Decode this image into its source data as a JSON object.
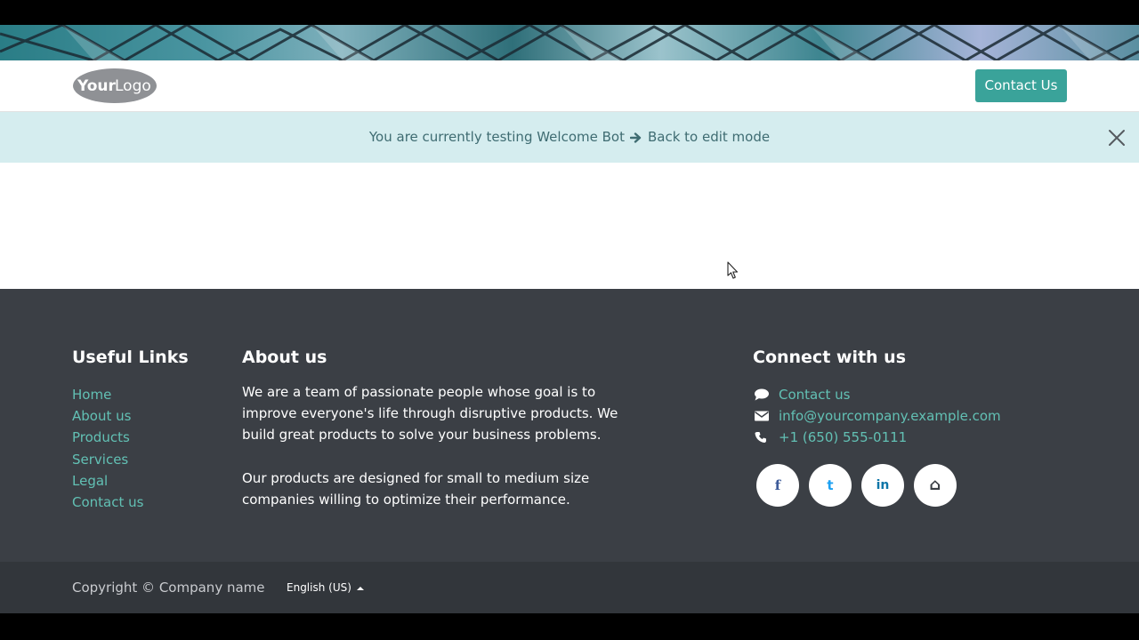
{
  "banner": {
    "image": "geometric-glass-ceiling"
  },
  "navbar": {
    "logo_text_bold": "Your",
    "logo_text_light": "Logo",
    "contact_button": "Contact Us"
  },
  "testbar": {
    "message": "You are currently testing Welcome Bot",
    "back_link": "Back to edit mode",
    "close_icon": "close-icon"
  },
  "footer": {
    "useful_links": {
      "title": "Useful Links",
      "items": [
        "Home",
        "About us",
        "Products",
        "Services",
        "Legal",
        "Contact us"
      ]
    },
    "about": {
      "title": "About us",
      "paragraph1": "We are a team of passionate people whose goal is to improve everyone's life through disruptive products. We build great products to solve your business problems.",
      "paragraph2": "Our products are designed for small to medium size companies willing to optimize their performance."
    },
    "connect": {
      "title": "Connect with us",
      "items": [
        {
          "icon": "comment-icon",
          "label": "Contact us"
        },
        {
          "icon": "envelope-icon",
          "label": "info@yourcompany.example.com"
        },
        {
          "icon": "phone-icon",
          "label": "+1 (650) 555-0111"
        }
      ],
      "socials": [
        {
          "icon": "facebook-icon",
          "glyph": "f",
          "color": "#3b5998"
        },
        {
          "icon": "twitter-icon",
          "glyph": "t",
          "color": "#1da1f2"
        },
        {
          "icon": "linkedin-icon",
          "glyph": "in",
          "color": "#0e76a8"
        },
        {
          "icon": "home-icon",
          "glyph": "⌂",
          "color": "#3b3f45"
        }
      ]
    }
  },
  "copyright": {
    "text": "Copyright © Company name",
    "language": "English (US)"
  },
  "colors": {
    "accent": "#3aa39a",
    "link": "#62c0b4",
    "footer_bg": "#3b3f45",
    "copyright_bg": "#32363b",
    "testbar_bg": "#d5edef"
  }
}
